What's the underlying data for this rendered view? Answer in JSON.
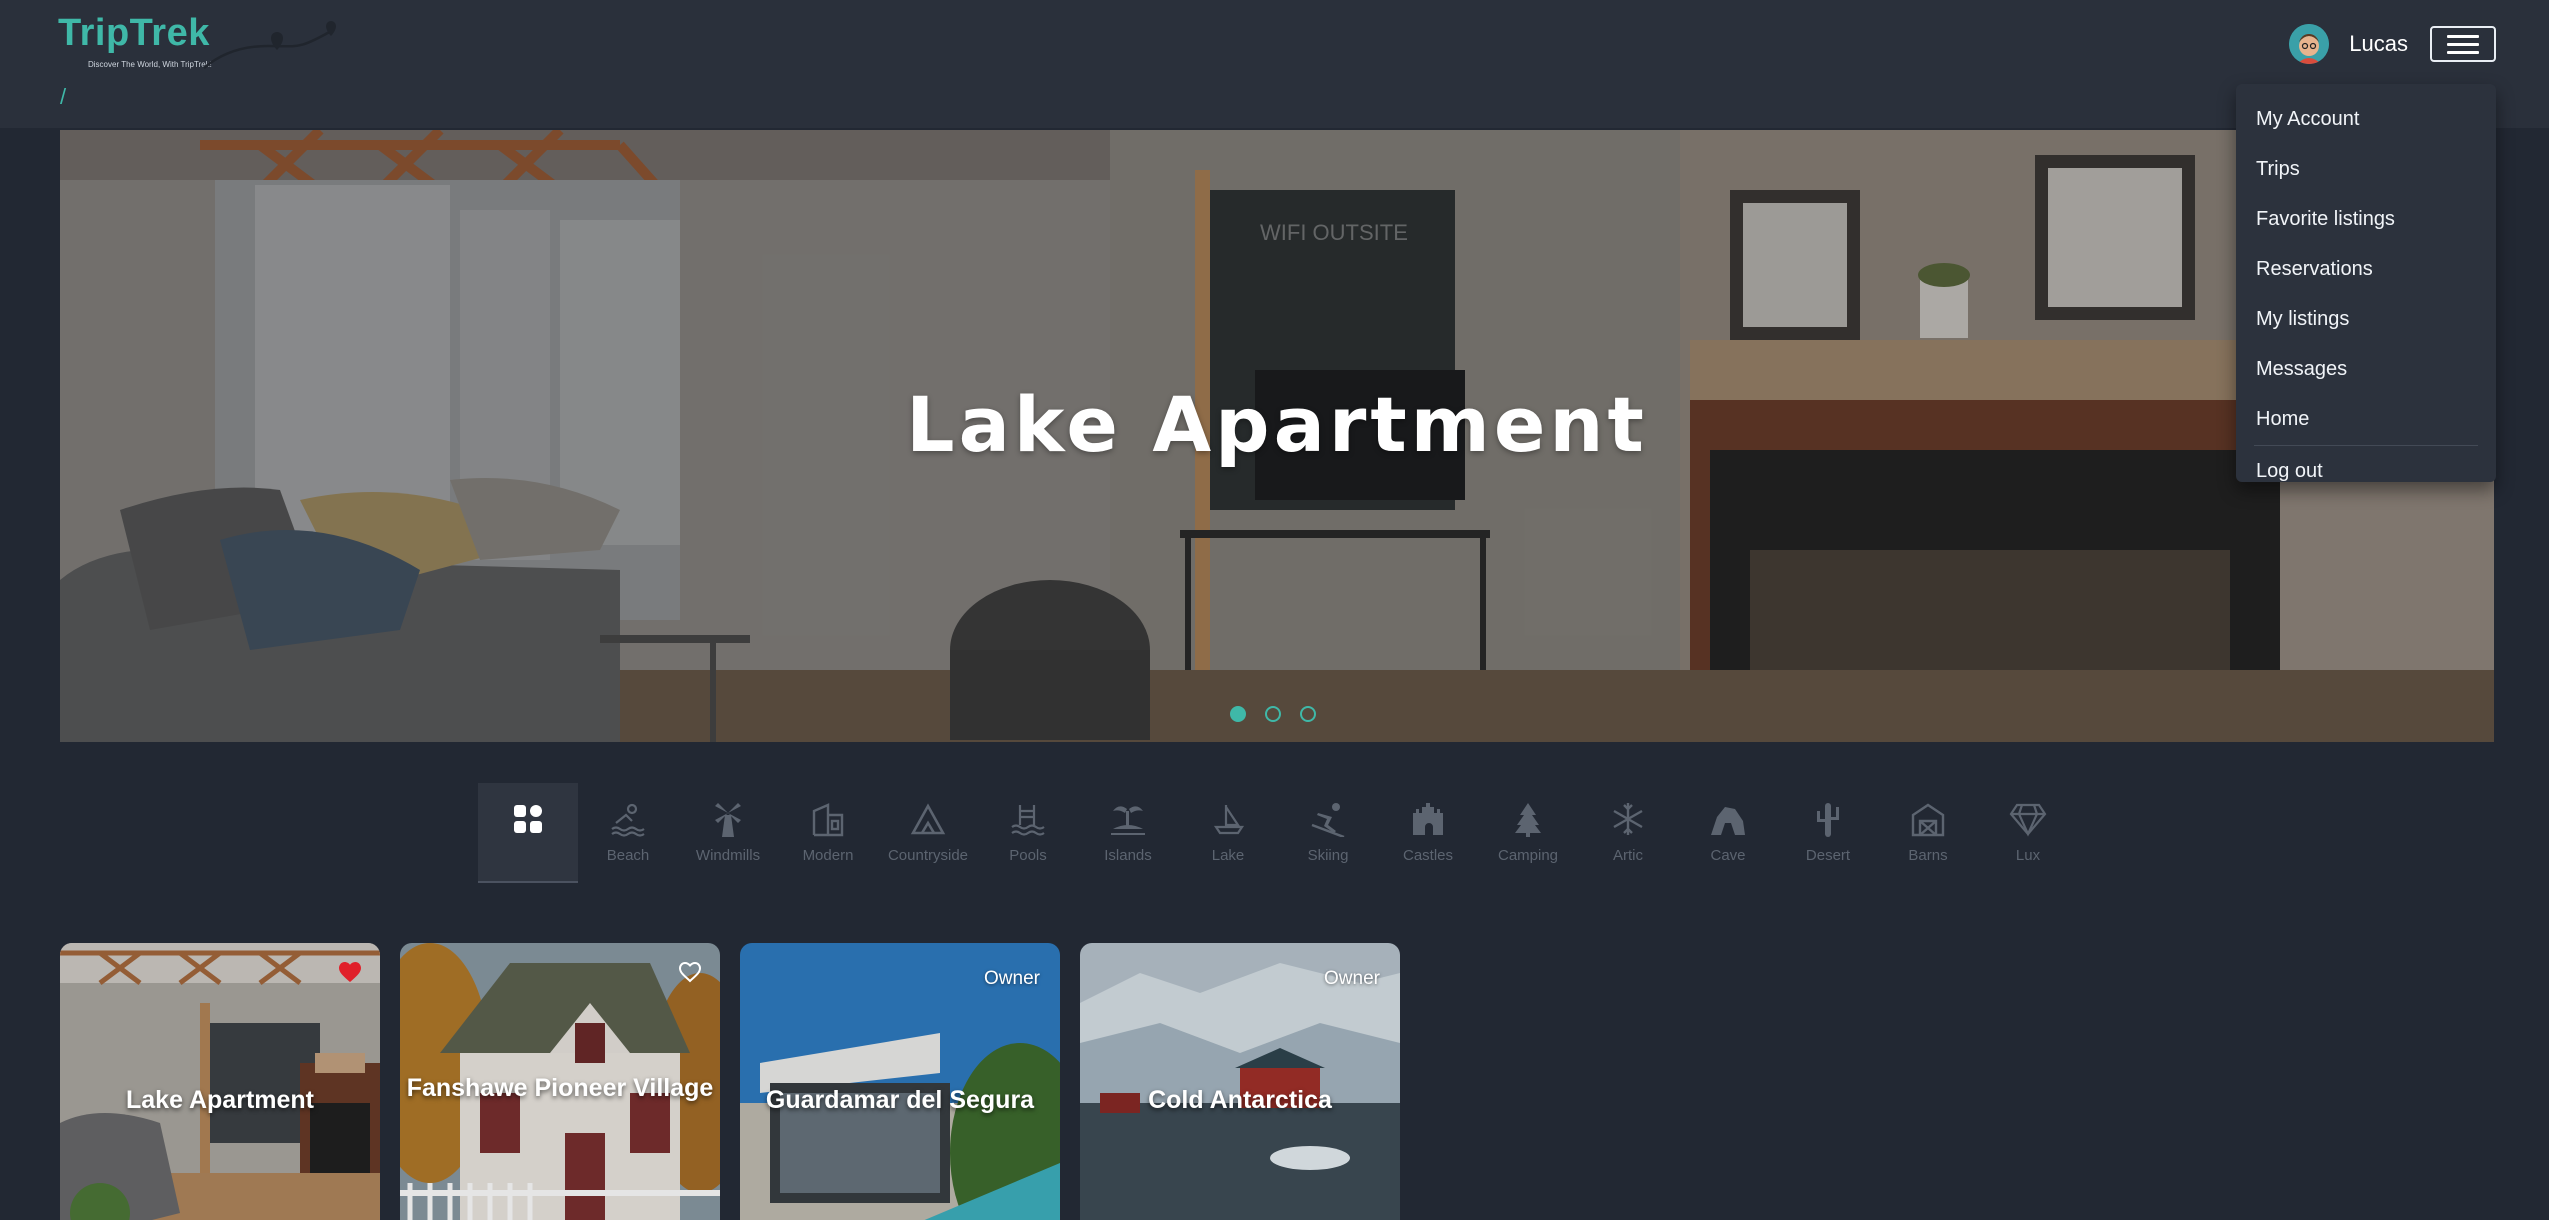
{
  "brand": {
    "name": "TripTrek",
    "tagline": "Discover The World, With TripTrek!",
    "color": "#3fb8a8"
  },
  "breadcrumb": {
    "separator": "/"
  },
  "user": {
    "name": "Lucas",
    "avatar_icon": "user-avatar",
    "menu_icon": "hamburger-icon"
  },
  "dropdown": {
    "items": [
      "My Account",
      "Trips",
      "Favorite listings",
      "Reservations",
      "My listings",
      "Messages",
      "Home"
    ],
    "logout": "Log out"
  },
  "hero": {
    "title": "Lake Apartment",
    "slides": 3,
    "active_slide": 1
  },
  "categories": [
    {
      "label": "",
      "icon": "grid-icon",
      "active": true
    },
    {
      "label": "Beach",
      "icon": "beach-icon"
    },
    {
      "label": "Windmills",
      "icon": "windmill-icon"
    },
    {
      "label": "Modern",
      "icon": "modern-building-icon"
    },
    {
      "label": "Countryside",
      "icon": "mountain-icon"
    },
    {
      "label": "Pools",
      "icon": "pool-icon"
    },
    {
      "label": "Islands",
      "icon": "island-icon"
    },
    {
      "label": "Lake",
      "icon": "sailboat-icon"
    },
    {
      "label": "Skiing",
      "icon": "skiing-icon"
    },
    {
      "label": "Castles",
      "icon": "castle-icon"
    },
    {
      "label": "Camping",
      "icon": "tree-icon"
    },
    {
      "label": "Artic",
      "icon": "snowflake-icon"
    },
    {
      "label": "Cave",
      "icon": "cave-icon"
    },
    {
      "label": "Desert",
      "icon": "cactus-icon"
    },
    {
      "label": "Barns",
      "icon": "barn-icon"
    },
    {
      "label": "Lux",
      "icon": "diamond-icon"
    }
  ],
  "listings": [
    {
      "title": "Lake Apartment",
      "badge": "",
      "favorite": true
    },
    {
      "title": "Fanshawe Pioneer Village",
      "badge": "",
      "favorite": false
    },
    {
      "title": "Guardamar del Segura",
      "badge": "Owner",
      "favorite": null
    },
    {
      "title": "Cold Antarctica",
      "badge": "Owner",
      "favorite": null
    }
  ],
  "colors": {
    "background": "#222833",
    "header": "#2a303b",
    "accent": "#3fb8a8",
    "heart": "#e0202a"
  }
}
